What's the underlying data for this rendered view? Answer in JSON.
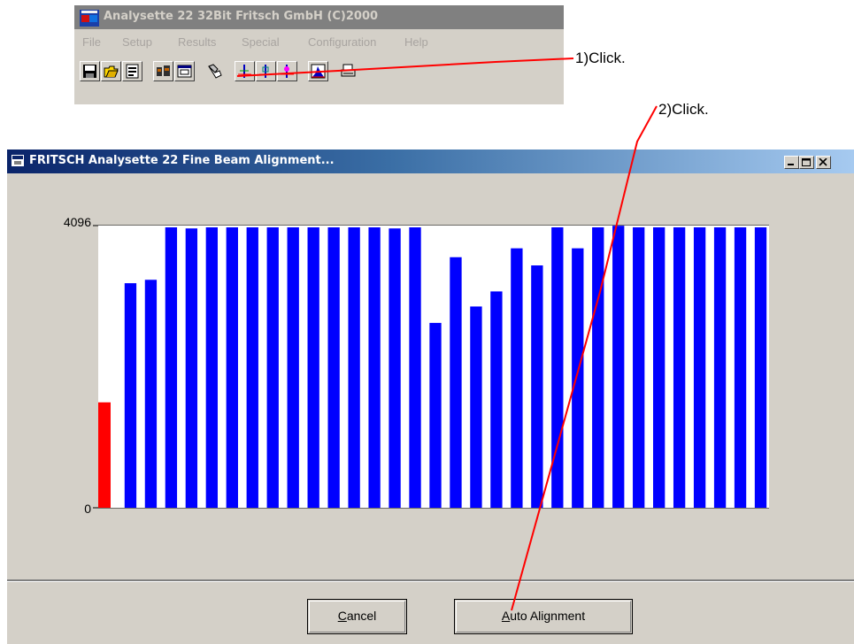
{
  "app": {
    "title": "Analysette 22 32Bit Fritsch GmbH (C)2000",
    "menu": [
      "File",
      "Setup",
      "Results",
      "Special",
      "Configuration",
      "Help"
    ],
    "toolbar_icons": [
      "save-icon",
      "open-folder-icon",
      "report-icon",
      "measure-icon",
      "window-icon",
      "probe-icon",
      "beam-adjust-icon",
      "beam-adjust-icon",
      "beam-adjust-icon",
      "histogram-icon",
      "print-icon"
    ]
  },
  "dialog": {
    "title": "FRITSCH Analysette 22 Fine Beam Alignment...",
    "buttons": {
      "cancel_accel": "C",
      "cancel_rest": "ancel",
      "auto_accel": "A",
      "auto_rest": "uto Alignment"
    }
  },
  "chart_data": {
    "type": "bar",
    "ylim": [
      0,
      4096
    ],
    "ytick_labels": [
      "4096",
      "0"
    ],
    "grid": true,
    "bar_color": "#0000ff",
    "highlight_color": "#ff0000",
    "highlight_index": 0,
    "values": [
      1540,
      3280,
      3330,
      4096,
      4080,
      4096,
      4096,
      4096,
      4096,
      4096,
      4096,
      4096,
      4096,
      4096,
      4080,
      4096,
      2700,
      3660,
      2940,
      3160,
      3790,
      3540,
      4096,
      3790,
      4096,
      4120,
      4096,
      4096,
      4096,
      4096,
      4096,
      4096,
      4096
    ]
  },
  "annotations": {
    "step1": "1)Click.",
    "step2": "2)Click.",
    "line_color": "#ff0000"
  }
}
